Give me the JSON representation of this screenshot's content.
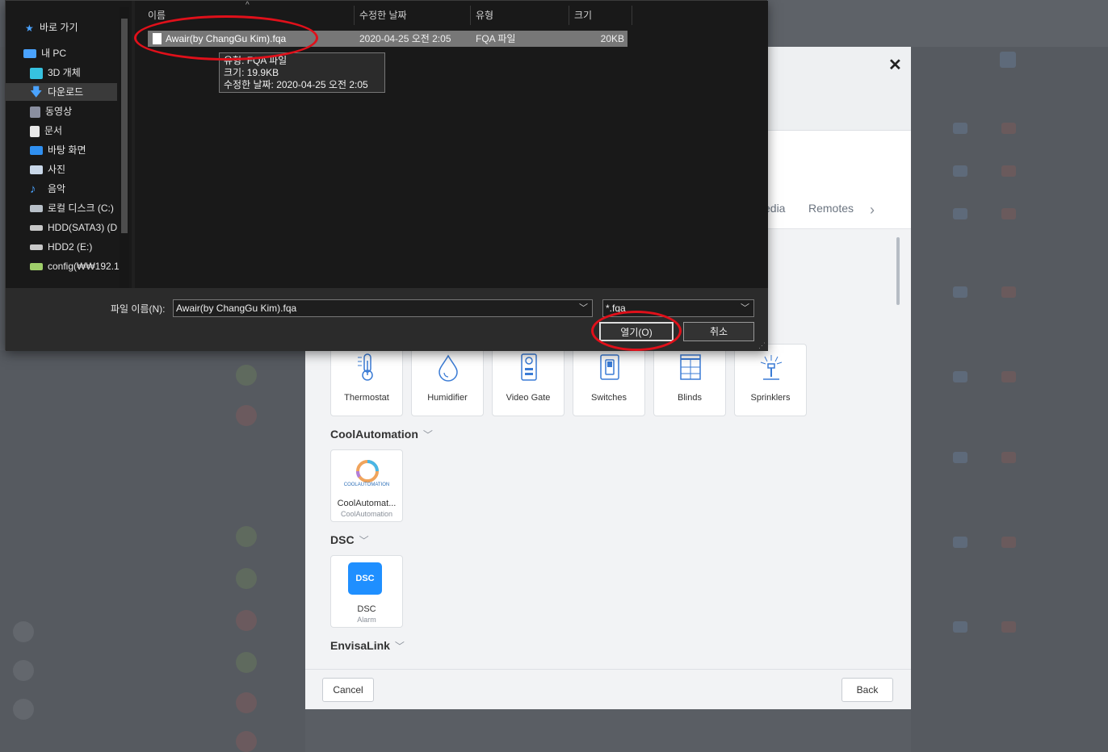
{
  "file_dialog": {
    "nav": {
      "items": [
        {
          "label": "바로 가기",
          "icon": "star-icon"
        },
        {
          "label": "내 PC",
          "icon": "computer-icon"
        },
        {
          "label": "3D 개체",
          "icon": "cube-icon"
        },
        {
          "label": "다운로드",
          "icon": "download-arrow-icon"
        },
        {
          "label": "동영상",
          "icon": "video-icon"
        },
        {
          "label": "문서",
          "icon": "document-icon"
        },
        {
          "label": "바탕 화면",
          "icon": "desktop-icon"
        },
        {
          "label": "사진",
          "icon": "picture-icon"
        },
        {
          "label": "음악",
          "icon": "music-note-icon"
        },
        {
          "label": "로컬 디스크 (C:)",
          "icon": "local-disk-icon"
        },
        {
          "label": "HDD(SATA3) (D",
          "icon": "drive-icon"
        },
        {
          "label": "HDD2 (E:)",
          "icon": "drive-icon"
        },
        {
          "label": "config(₩₩192.1",
          "icon": "network-drive-icon"
        }
      ]
    },
    "columns": {
      "name": "이름",
      "modified": "수정한 날짜",
      "type": "유형",
      "size": "크기"
    },
    "file": {
      "name": "Awair(by ChangGu Kim).fqa",
      "modified": "2020-04-25 오전 2:05",
      "type": "FQA 파일",
      "size": "20KB"
    },
    "tooltip": {
      "line1": "유형: FQA 파일",
      "line2": "크기: 19.9KB",
      "line3": "수정한 날짜: 2020-04-25 오전 2:05"
    },
    "filename_label": "파일 이름(N):",
    "filename_value": "Awair(by ChangGu Kim).fqa",
    "filter_value": "*.fqa",
    "open_button": "열기(O)",
    "cancel_button": "취소"
  },
  "modal": {
    "tabs": {
      "partial": "edia",
      "remotes": "Remotes"
    },
    "cards_row1": [
      {
        "label": "Thermostat",
        "icon": "thermostat-icon"
      },
      {
        "label": "Humidifier",
        "icon": "humidifier-drop-icon"
      },
      {
        "label": "Video Gate",
        "icon": "video-gate-icon"
      },
      {
        "label": "Switches",
        "icon": "switch-icon"
      },
      {
        "label": "Blinds",
        "icon": "blinds-icon"
      },
      {
        "label": "Sprinklers",
        "icon": "sprinkler-icon"
      }
    ],
    "sections": [
      {
        "title": "CoolAutomation",
        "card_label": "CoolAutomat...",
        "card_sub": "CoolAutomation",
        "logo_text": "COOLAUTOMATION"
      },
      {
        "title": "DSC",
        "card_label": "DSC",
        "card_sub": "Alarm",
        "logo_text": "DSC"
      },
      {
        "title": "EnvisaLink"
      }
    ],
    "cancel": "Cancel",
    "back": "Back"
  },
  "colors": {
    "accent_blue": "#1f8fff",
    "annotation_red": "#e0101a",
    "icon_blue": "#3a7bd5"
  }
}
